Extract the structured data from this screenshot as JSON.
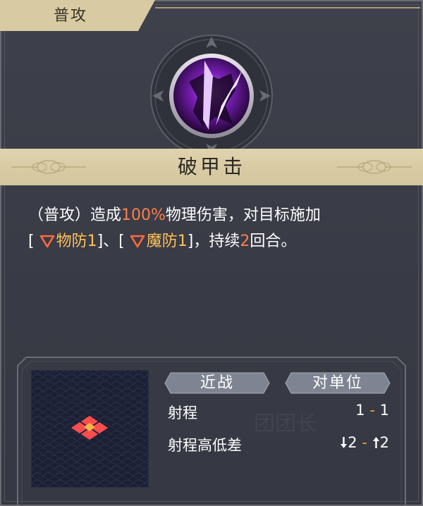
{
  "tab": {
    "label": "普攻"
  },
  "skill": {
    "name": "破甲击",
    "icon": "purple-slash-icon"
  },
  "description": {
    "prefix": "（普攻）造成",
    "damage": "100%",
    "mid": "物理伤害，对目标施加",
    "open1": "[",
    "debuff1": "物防1",
    "close1": "]、[",
    "debuff2": "魔防1",
    "close2": "]，持续",
    "turns": "2",
    "suffix": "回合。"
  },
  "tags": {
    "range_type": "近战",
    "target_type": "对单位"
  },
  "stats": {
    "range_label": "射程",
    "range_min": "1",
    "range_sep": "-",
    "range_max": "1",
    "height_label": "射程高低差",
    "height_down": "2",
    "height_sep": "-",
    "height_up": "2"
  },
  "watermark": "团团长",
  "colors": {
    "accent_orange": "#ff7f4a",
    "debuff_gold": "#ffc05a",
    "banner": "#d8cba3",
    "panel": "#3b3d48"
  }
}
